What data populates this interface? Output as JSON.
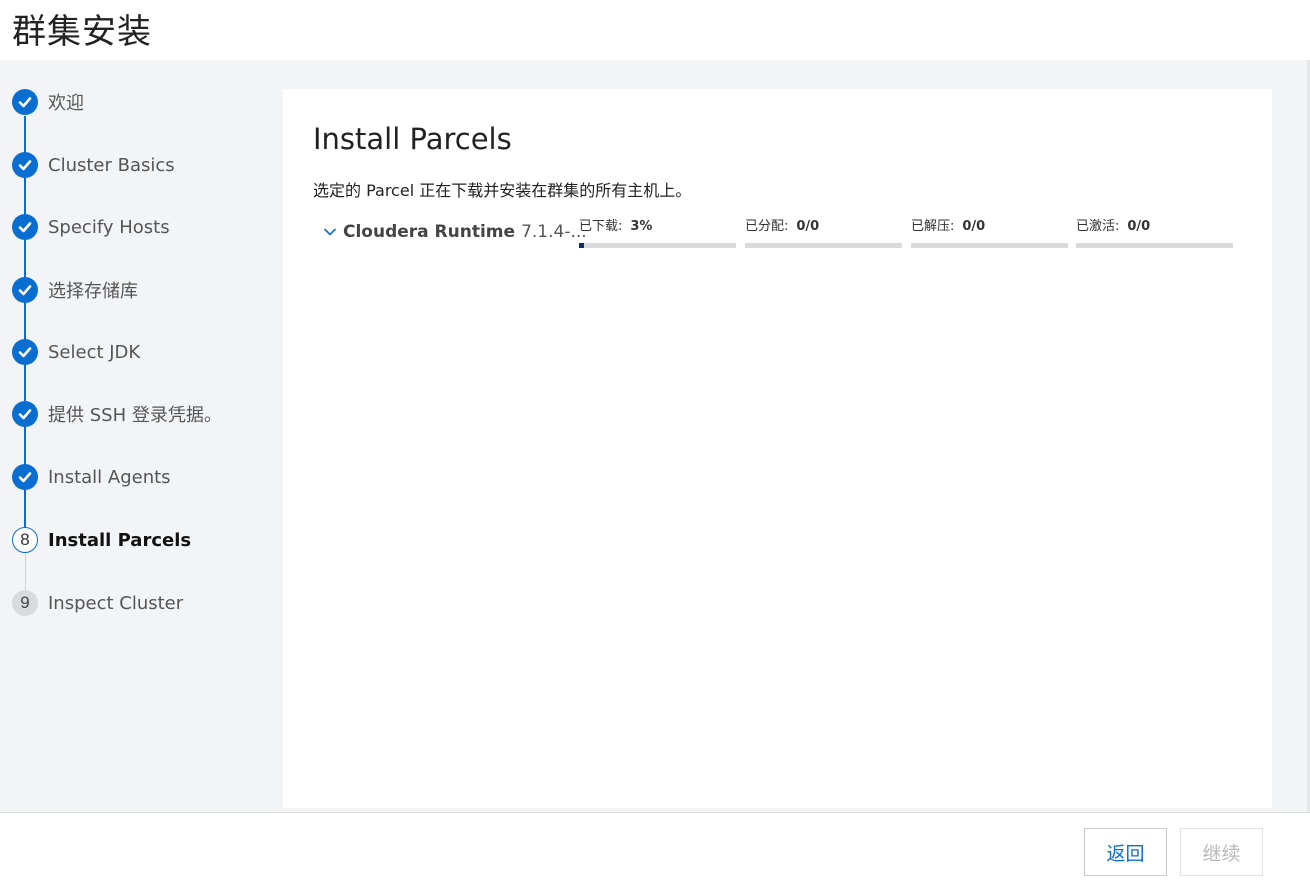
{
  "header": {
    "title": "群集安装"
  },
  "sidebar": {
    "steps": [
      {
        "label": "欢迎",
        "status": "done"
      },
      {
        "label": "Cluster Basics",
        "status": "done"
      },
      {
        "label": "Specify Hosts",
        "status": "done"
      },
      {
        "label": "选择存储库",
        "status": "done"
      },
      {
        "label": "Select JDK",
        "status": "done"
      },
      {
        "label": "提供 SSH 登录凭据。",
        "status": "done"
      },
      {
        "label": "Install Agents",
        "status": "done"
      },
      {
        "label": "Install Parcels",
        "status": "current",
        "number": "8"
      },
      {
        "label": "Inspect Cluster",
        "status": "pending",
        "number": "9"
      }
    ]
  },
  "main": {
    "title": "Install Parcels",
    "description": "选定的 Parcel 正在下载并安装在群集的所有主机上。",
    "parcel": {
      "name": "Cloudera Runtime",
      "version": "7.1.4-...",
      "stages": [
        {
          "label": "已下载:",
          "value": "3%",
          "progress": 0.03
        },
        {
          "label": "已分配:",
          "value": "0/0",
          "progress": 0
        },
        {
          "label": "已解压:",
          "value": "0/0",
          "progress": 0
        },
        {
          "label": "已激活:",
          "value": "0/0",
          "progress": 0
        }
      ]
    }
  },
  "footer": {
    "back_label": "返回",
    "continue_label": "继续"
  },
  "colors": {
    "accent": "#0a6ed1",
    "progress": "#0b2e6b",
    "disabled": "#b8b9bb"
  }
}
